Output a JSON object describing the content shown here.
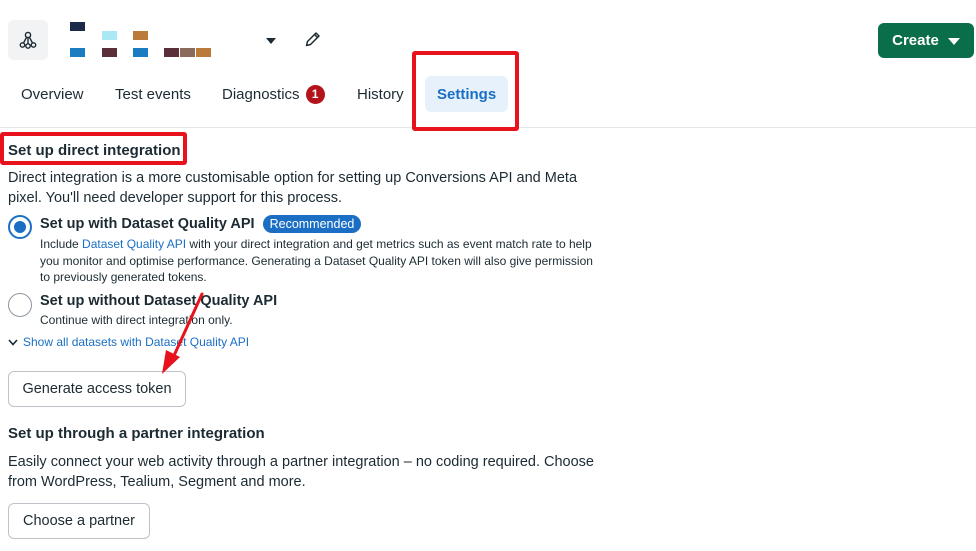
{
  "header": {
    "swatch_colors": [
      "#1c2a4a",
      "#a9e8f5",
      "#b97a3a",
      "#1a7cc1",
      "#5a2f3a",
      "#1a7cc1",
      "#5a2f3a",
      "#8a6a5a",
      "#b97a3a",
      "#f0bc86"
    ],
    "create_label": "Create"
  },
  "tabs": [
    {
      "label": "Overview"
    },
    {
      "label": "Test events"
    },
    {
      "label": "Diagnostics",
      "badge": "1"
    },
    {
      "label": "History"
    },
    {
      "label": "Settings",
      "active": true
    }
  ],
  "direct": {
    "title": "Set up direct integration",
    "description": "Direct integration is a more customisable option for setting up Conversions API and Meta pixel. You'll need developer support for this process.",
    "option1": {
      "title": "Set up with Dataset Quality API",
      "badge": "Recommended",
      "desc_before": "Include ",
      "desc_link": "Dataset Quality API",
      "desc_after": " with your direct integration and get metrics such as event match rate to help you monitor and optimise performance. Generating a Dataset Quality API token will also give permission to previously generated tokens.",
      "selected": true
    },
    "option2": {
      "title": "Set up without Dataset Quality API",
      "desc": "Continue with direct integration only.",
      "selected": false
    },
    "show_all_label": "Show all datasets with Dataset Quality API",
    "generate_label": "Generate access token"
  },
  "partner": {
    "title": "Set up through a partner integration",
    "description": "Easily connect your web activity through a partner integration – no coding required. Choose from WordPress, Tealium, Segment and more.",
    "button_label": "Choose a partner"
  },
  "colors": {
    "accent": "#1a6fc4",
    "create_green": "#0a6e4a",
    "badge_red": "#b3141c",
    "annotation_red": "#e8121c"
  }
}
